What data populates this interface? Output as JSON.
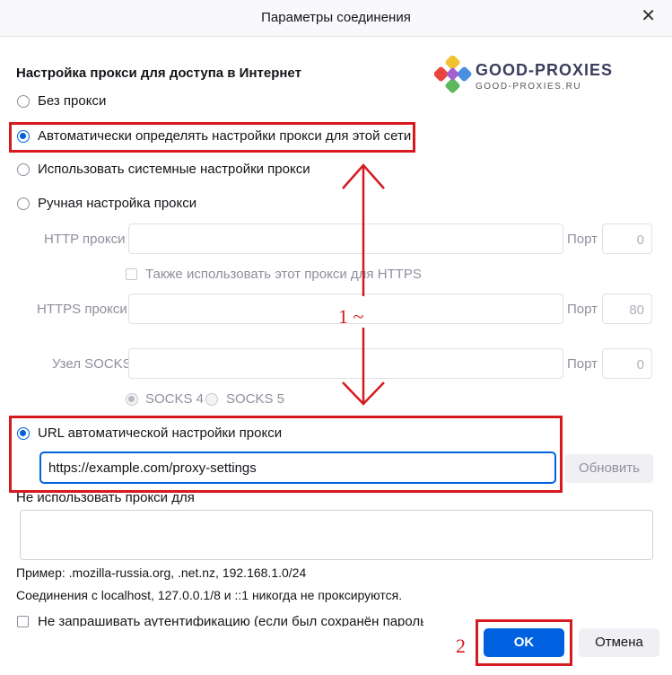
{
  "window": {
    "title": "Параметры соединения",
    "close": "✕"
  },
  "logo": {
    "brand_a": "GOOD",
    "brand_b": "-PROXIES",
    "sub": "GOOD-PROXIES.RU"
  },
  "section_title": "Настройка прокси для доступа в Интернет",
  "options": {
    "no_proxy": "Без прокси",
    "auto_detect": "Автоматически определять настройки прокси для этой сети",
    "system": "Использовать системные настройки прокси",
    "manual": "Ручная настройка прокси",
    "pac": "URL автоматической настройки прокси"
  },
  "manual": {
    "http_label": "HTTP прокси",
    "port_label": "Порт",
    "http_port": "0",
    "also_https": "Также использовать этот прокси для HTTPS",
    "https_label": "HTTPS прокси",
    "https_port": "80",
    "socks_label": "Узел SOCKS",
    "socks_port": "0",
    "socks4": "SOCKS 4",
    "socks5": "SOCKS 5"
  },
  "pac": {
    "url": "https://example.com/proxy-settings",
    "reload": "Обновить"
  },
  "no_proxy_for": {
    "label": "Не использовать прокси для",
    "example": "Пример: .mozilla-russia.org, .net.nz, 192.168.1.0/24",
    "note": "Соединения с localhost, 127.0.0.1/8 и ::1 никогда не проксируются."
  },
  "auth_checkbox": "Не запрашивать аутентификацию (если был сохранён пароль)",
  "buttons": {
    "ok": "OK",
    "cancel": "Отмена"
  },
  "annotations": {
    "step1": "1 ~",
    "step2": "2"
  },
  "colors": {
    "accent": "#0061e0",
    "annotation_red": "#d6191f"
  }
}
